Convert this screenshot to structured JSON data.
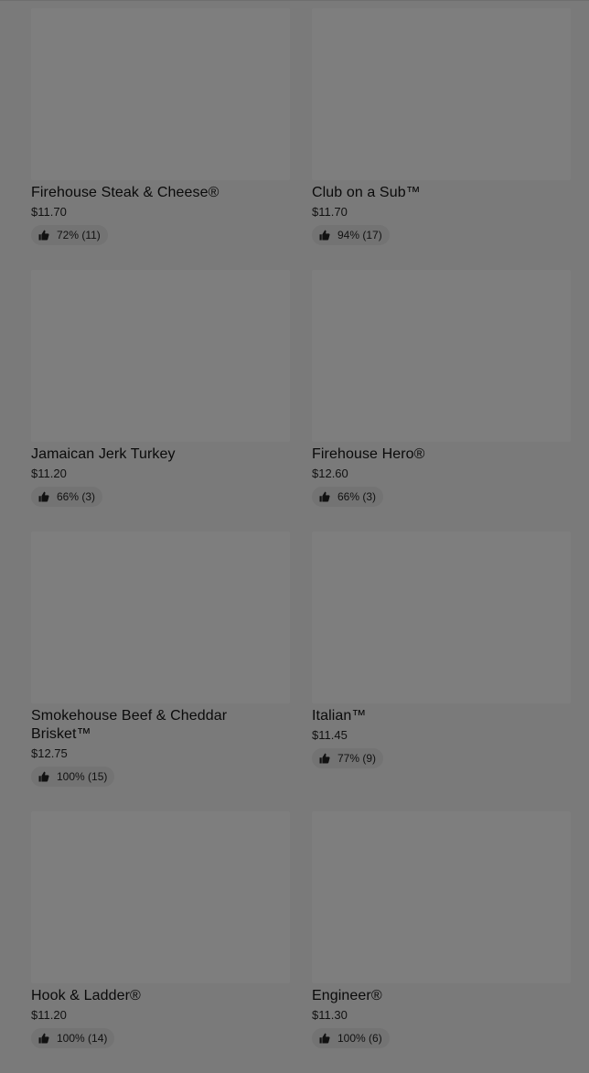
{
  "menu_items": [
    {
      "name": "Firehouse Steak & Cheese®",
      "price": "$11.70",
      "rating": "72% (11)"
    },
    {
      "name": "Club on a Sub™",
      "price": "$11.70",
      "rating": "94% (17)"
    },
    {
      "name": "Jamaican Jerk Turkey",
      "price": "$11.20",
      "rating": "66% (3)"
    },
    {
      "name": "Firehouse Hero®",
      "price": "$12.60",
      "rating": "66% (3)"
    },
    {
      "name": "Smokehouse Beef & Cheddar Brisket™",
      "price": "$12.75",
      "rating": "100% (15)"
    },
    {
      "name": "Italian™",
      "price": "$11.45",
      "rating": "77% (9)"
    },
    {
      "name": "Hook & Ladder®",
      "price": "$11.20",
      "rating": "100% (14)"
    },
    {
      "name": "Engineer®",
      "price": "$11.30",
      "rating": "100% (6)"
    }
  ],
  "icons": {
    "rating_icon": "thumbs-up-icon"
  },
  "colors": {
    "overlay": "#7a7a7a",
    "image_placeholder": "#7e7e7e",
    "rating_pill": "#737373"
  }
}
